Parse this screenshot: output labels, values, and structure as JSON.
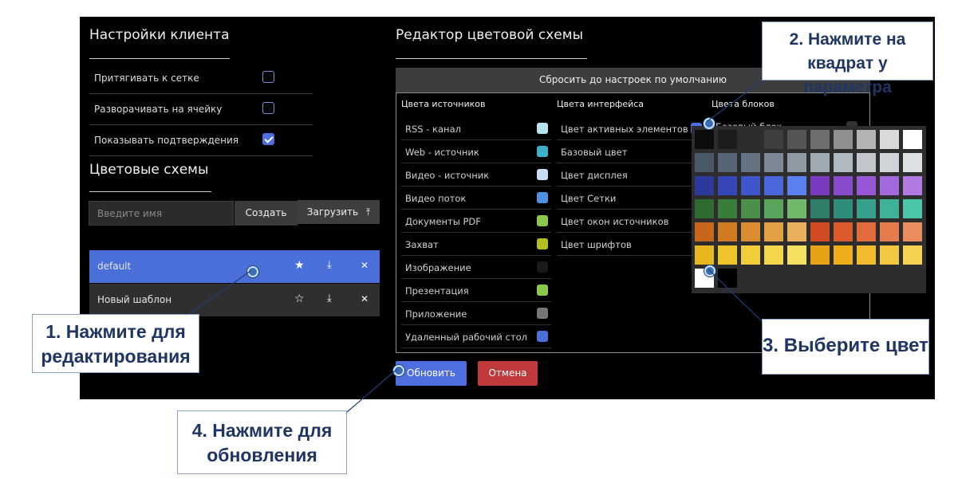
{
  "client_settings": {
    "title": "Настройки клиента",
    "options": [
      {
        "label": "Притягивать к сетке",
        "checked": false
      },
      {
        "label": "Разворачивать на ячейку",
        "checked": false
      },
      {
        "label": "Показывать подтверждения",
        "checked": true
      }
    ]
  },
  "schemes": {
    "title": "Цветовые схемы",
    "name_placeholder": "Введите имя",
    "create_label": "Создать",
    "load_label": "Загрузить",
    "templates": [
      {
        "name": "default",
        "active": true
      },
      {
        "name": "Новый шаблон",
        "active": false
      }
    ]
  },
  "editor": {
    "title": "Редактор цветовой схемы",
    "reset_label": "Сбросить до настроек по умолчанию",
    "col_sources": "Цвета источников",
    "col_interface": "Цвета интерфейса",
    "col_blocks": "Цвета блоков",
    "sources": [
      {
        "label": "RSS - канал",
        "color": "#b8e4ee"
      },
      {
        "label": "Web - источник",
        "color": "#3fb0cc"
      },
      {
        "label": "Видео - источник",
        "color": "#c9ddf5"
      },
      {
        "label": "Видео поток",
        "color": "#4e8fe6"
      },
      {
        "label": "Документы PDF",
        "color": "#8cc84b"
      },
      {
        "label": "Захват",
        "color": "#b4bf1f"
      },
      {
        "label": "Изображение",
        "color": "#1a1a1a"
      },
      {
        "label": "Презентация",
        "color": "#8cc84b"
      },
      {
        "label": "Приложение",
        "color": "#777777"
      },
      {
        "label": "Удаленный рабочий стол",
        "color": "#4a6fd8"
      }
    ],
    "interface": [
      {
        "label": "Цвет активных элементов",
        "color": "#4f6fe0"
      },
      {
        "label": "Базовый цвет"
      },
      {
        "label": "Цвет дисплея"
      },
      {
        "label": "Цвет Сетки"
      },
      {
        "label": "Цвет окон источников"
      },
      {
        "label": "Цвет шрифтов"
      }
    ],
    "blocks_partial": "Базовый блок",
    "update_label": "Обновить",
    "cancel_label": "Отмена"
  },
  "palette": {
    "rows": [
      [
        "#0c0c0c",
        "#1c1c1c",
        "#2c2c2c",
        "#3e3e3e",
        "#555555",
        "#6e6e6e",
        "#8f8f8f",
        "#b4b4b4",
        "#dadada",
        "#ffffff"
      ],
      [
        "#4b5866",
        "#586574",
        "#667382",
        "#7b8794",
        "#8e99a4",
        "#a0aab3",
        "#b1b9c0",
        "#c1c7cc",
        "#cfd4d8",
        "#dde1e4"
      ],
      [
        "#2b3a9c",
        "#3446b8",
        "#3f56cc",
        "#4a68dc",
        "#5a7fee",
        "#7a3bc0",
        "#8a4acc",
        "#9858d6",
        "#a469de",
        "#b17ae2"
      ],
      [
        "#2e6b2e",
        "#3a7d3a",
        "#4a904a",
        "#5ba45b",
        "#72b86a",
        "#2e7e6a",
        "#2f8e7a",
        "#36a08a",
        "#3eb39a",
        "#4cc6ab"
      ],
      [
        "#c8661a",
        "#d27a22",
        "#db8d2e",
        "#e39f44",
        "#eab05b",
        "#d24a22",
        "#dc5a2e",
        "#e26a3c",
        "#e67b4c",
        "#ea8c5e"
      ],
      [
        "#e6b81f",
        "#edc42a",
        "#f1cd3a",
        "#f4d64d",
        "#f6e062",
        "#e6a214",
        "#eeae1c",
        "#f2bb2e",
        "#f4c740",
        "#f5d252"
      ]
    ],
    "last_row": [
      "#ffffff",
      "#000000"
    ]
  },
  "callouts": {
    "c1": "1. Нажмите для редактирования",
    "c2": "2. Нажмите на квадрат у параметра",
    "c3": "3. Выберите цвет",
    "c4": "4. Нажмите для обновления"
  }
}
